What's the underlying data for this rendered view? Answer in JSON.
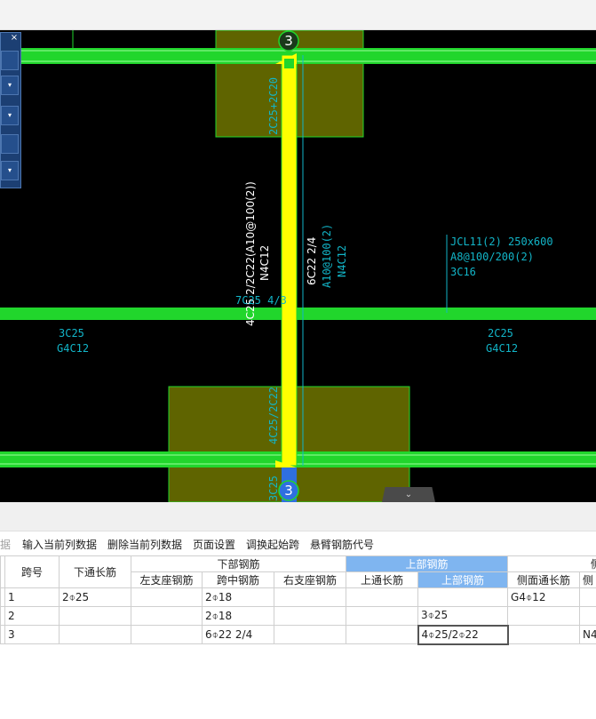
{
  "canvas": {
    "axis_labels": [
      "3",
      "3"
    ],
    "annotations": {
      "vertical_beam_left_1": "4C25 2/2C22(A10@100(2))",
      "vertical_beam_left_2": "N4C12",
      "vertical_beam_left_3": "7C25 4/3",
      "vertical_beam_right_1": "6C22 2/4",
      "vertical_beam_right_2": "A10@100(2)",
      "vertical_beam_right_3": "N4C12",
      "col_top": "2C25+2C20",
      "col_bottom": "4C25/2C22",
      "col_bottom2": "3C25",
      "jcl_1": "JCL11(2) 250x600",
      "jcl_2": "A8@100/200(2)",
      "jcl_3": "3C16",
      "left_mid_1": "3C25",
      "left_mid_2": "G4C12",
      "right_mid_1": "2C25",
      "right_mid_2": "G4C12"
    },
    "colors": {
      "background": "#000000",
      "beam_green": "#21d62c",
      "highlight_yellow": "#ffff00",
      "column_olive": "#5f6400",
      "text_cyan": "#12b5c8",
      "selected_blue": "#2f6fe0"
    }
  },
  "float_panel": {
    "close": "×"
  },
  "scroll_tab": "⌄",
  "menu": {
    "partial": "据",
    "items": [
      "输入当前列数据",
      "删除当前列数据",
      "页面设置",
      "调换起始跨",
      "悬臂钢筋代号"
    ]
  },
  "table": {
    "headers_top": {
      "span_no": "跨号",
      "bottom_through": "下通长筋",
      "bottom_rebar": "下部钢筋",
      "top_rebar": "上部钢筋",
      "side_partial": "侧"
    },
    "headers_sub": {
      "left_support": "左支座钢筋",
      "mid_span": "跨中钢筋",
      "right_support": "右支座钢筋",
      "top_through": "上通长筋",
      "top_rebar": "上部钢筋",
      "side_through": "侧面通长筋",
      "side_partial": "侧"
    },
    "rows": [
      {
        "span": "1",
        "bottom_through": "2⌽25",
        "left_support": "",
        "mid_span": "2⌽18",
        "right_support": "",
        "top_through": "",
        "top_rebar": "",
        "side_through": "G4⌽12",
        "extra": ""
      },
      {
        "span": "2",
        "bottom_through": "",
        "left_support": "",
        "mid_span": "2⌽18",
        "right_support": "",
        "top_through": "",
        "top_rebar": "3⌽25",
        "side_through": "",
        "extra": ""
      },
      {
        "span": "3",
        "bottom_through": "",
        "left_support": "",
        "mid_span": "6⌽22 2/4",
        "right_support": "",
        "top_through": "",
        "top_rebar": "4⌽25/2⌽22",
        "side_through": "",
        "extra": "N4"
      }
    ]
  }
}
